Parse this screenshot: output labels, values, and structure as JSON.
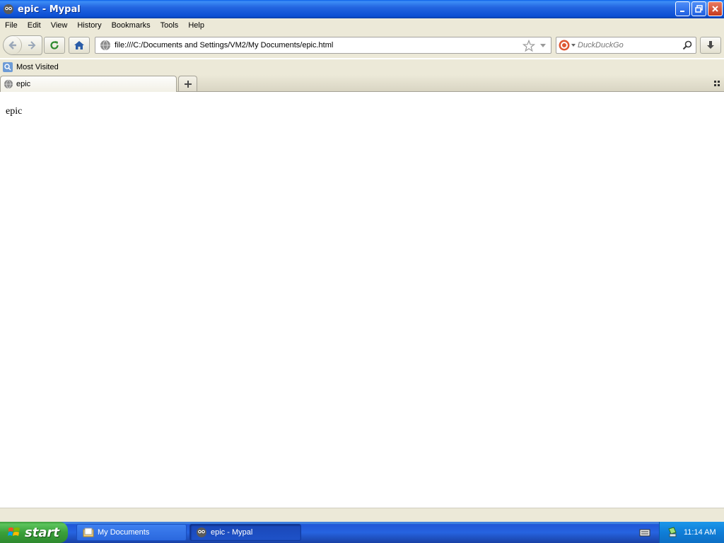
{
  "window": {
    "title": "epic - Mypal"
  },
  "menu": [
    "File",
    "Edit",
    "View",
    "History",
    "Bookmarks",
    "Tools",
    "Help"
  ],
  "nav": {
    "url": "file:///C:/Documents and Settings/VM2/My Documents/epic.html",
    "search_placeholder": "DuckDuckGo"
  },
  "bookmarks": {
    "items": [
      {
        "label": "Most Visited"
      }
    ]
  },
  "tabs": [
    {
      "label": "epic"
    }
  ],
  "page": {
    "text": "epic"
  },
  "taskbar": {
    "start_label": "start",
    "tasks": [
      {
        "label": "My Documents"
      },
      {
        "label": "epic - Mypal"
      }
    ],
    "clock": "11:14 AM"
  },
  "colors": {
    "titlebar": "#2365e0",
    "chrome": "#ece9d8",
    "start_green": "#3aa03a",
    "tray_blue": "#0f7ed8"
  }
}
